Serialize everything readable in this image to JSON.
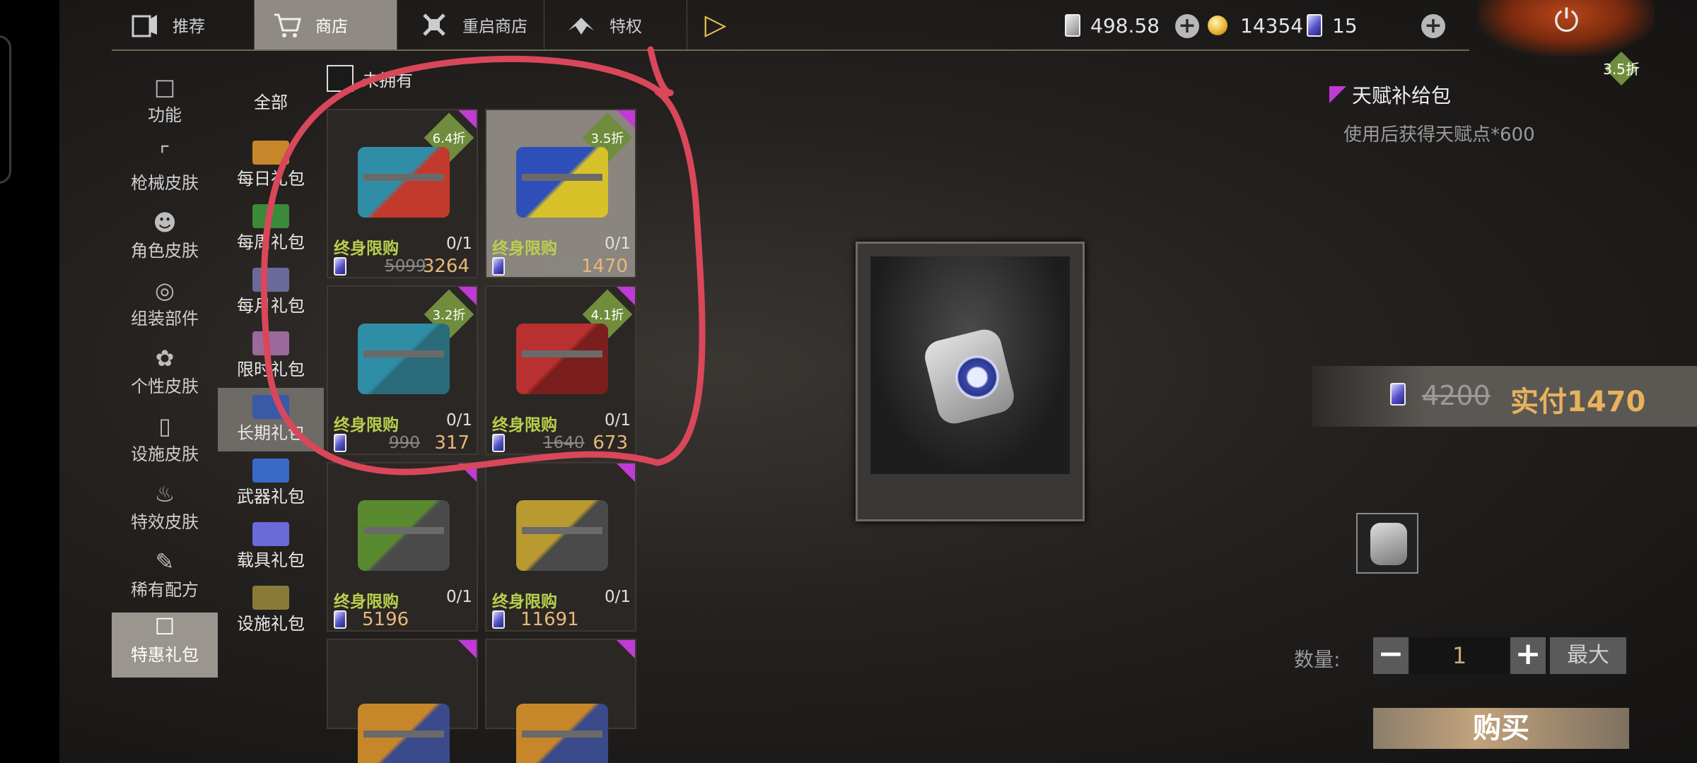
{
  "top_tabs": [
    {
      "label": "推荐",
      "icon": "recommend-icon"
    },
    {
      "label": "商店",
      "icon": "cart-icon",
      "active": true
    },
    {
      "label": "重启商店",
      "icon": "restart-shop-icon"
    },
    {
      "label": "特权",
      "icon": "privilege-icon"
    }
  ],
  "currencies": {
    "premium": "498.58",
    "coins": "14354",
    "tickets": "15"
  },
  "categories": [
    {
      "label": "功能",
      "icon": "function-icon"
    },
    {
      "label": "枪械皮肤",
      "icon": "pistol-icon"
    },
    {
      "label": "角色皮肤",
      "icon": "character-icon"
    },
    {
      "label": "组装部件",
      "icon": "steering-wheel-icon"
    },
    {
      "label": "个性皮肤",
      "icon": "personal-skin-icon"
    },
    {
      "label": "设施皮肤",
      "icon": "door-icon"
    },
    {
      "label": "特效皮肤",
      "icon": "effect-icon"
    },
    {
      "label": "稀有配方",
      "icon": "formula-icon"
    },
    {
      "label": "特惠礼包",
      "icon": "gift-icon",
      "active": true
    }
  ],
  "subcategories": [
    {
      "label": "全部"
    },
    {
      "label": "每日礼包"
    },
    {
      "label": "每周礼包"
    },
    {
      "label": "每月礼包"
    },
    {
      "label": "限时礼包"
    },
    {
      "label": "长期礼包",
      "active": true
    },
    {
      "label": "武器礼包"
    },
    {
      "label": "载具礼包"
    },
    {
      "label": "设施礼包"
    }
  ],
  "filter": {
    "label": "未拥有"
  },
  "items": [
    {
      "discount": "6.4折",
      "limit": "终身限购",
      "count": "0/1",
      "old": "5099",
      "price": "3264",
      "colors": [
        "#2f8ea6",
        "#c23a2c"
      ]
    },
    {
      "discount": "3.5折",
      "limit": "终身限购",
      "count": "0/1",
      "old": "4200",
      "price": "1470",
      "colors": [
        "#2f4fb8",
        "#d8c22a"
      ],
      "selected": true
    },
    {
      "discount": "3.2折",
      "limit": "终身限购",
      "count": "0/1",
      "old": "990",
      "price": "317",
      "colors": [
        "#2f8ea6",
        "#2a6b7a"
      ]
    },
    {
      "discount": "4.1折",
      "limit": "终身限购",
      "count": "0/1",
      "old": "1640",
      "price": "673",
      "colors": [
        "#b83030",
        "#7a1e1e"
      ]
    },
    {
      "discount": "",
      "limit": "终身限购",
      "count": "0/1",
      "old": "",
      "price": "5196",
      "colors": [
        "#5a8a30",
        "#4a4a4a"
      ]
    },
    {
      "discount": "",
      "limit": "终身限购",
      "count": "0/1",
      "old": "",
      "price": "11691",
      "colors": [
        "#b89a30",
        "#4a4a4a"
      ]
    },
    {
      "discount": "",
      "limit": "",
      "count": "",
      "old": "",
      "price": "",
      "colors": [
        "#c8862a",
        "#3a4a8a"
      ]
    },
    {
      "discount": "",
      "limit": "",
      "count": "",
      "old": "",
      "price": "",
      "colors": [
        "#c8862a",
        "#3a4a8a"
      ]
    }
  ],
  "detail": {
    "name": "天赋补给包",
    "desc": "使用后获得天赋点*600",
    "discount": "3.5折",
    "old_price": "4200",
    "pay": "实付1470",
    "qty_label": "数量:",
    "qty": "1",
    "max": "最大",
    "buy": "购买"
  }
}
